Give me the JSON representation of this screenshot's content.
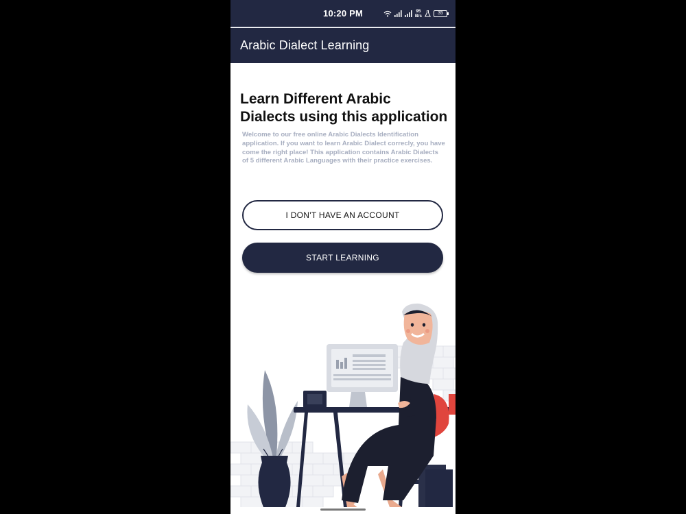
{
  "status_bar": {
    "time": "10:20 PM",
    "net_speed_value": "95",
    "net_speed_unit": "B/s",
    "battery_level": "35"
  },
  "app_bar": {
    "title": "Arabic Dialect Learning"
  },
  "main": {
    "headline": "Learn Different Arabic Dialects using this application",
    "intro": "Welcome to our free online Arabic Dialects Identification application. If you want to learn Arabic Dialect correcly, you have come the right place! This application contains Arabic Dialects of 5 different Arabic Languages with their practice exercises.",
    "no_account_label": "I DON'T HAVE AN ACCOUNT",
    "start_label": "START LEARNING"
  },
  "colors": {
    "primary": "#222842",
    "intro_text": "#a7aec0",
    "background": "#ffffff",
    "accent_chair": "#e0453d"
  }
}
